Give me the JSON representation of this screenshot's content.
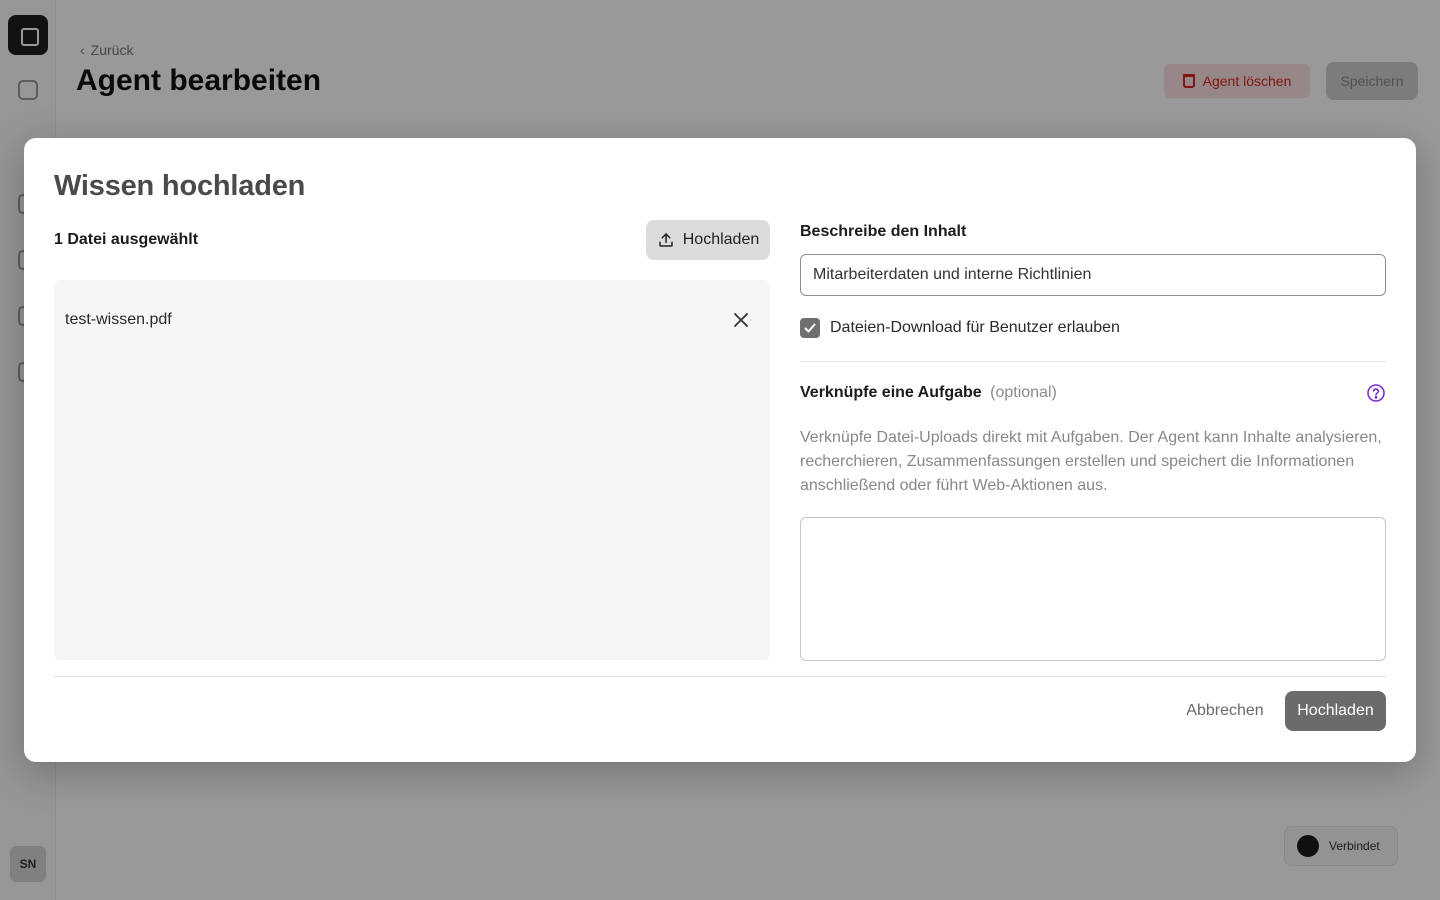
{
  "background": {
    "back_label": "Zurück",
    "page_title": "Agent bearbeiten",
    "delete_label": "Agent löschen",
    "save_label": "Speichern",
    "user_initials": "SN",
    "status_label": "Verbindet"
  },
  "modal": {
    "title": "Wissen hochladen",
    "selected_count": "1 Datei ausgewählt",
    "upload_small_label": "Hochladen",
    "files": [
      {
        "name": "test-wissen.pdf"
      }
    ],
    "description_label": "Beschreibe den Inhalt",
    "description_value": "Mitarbeiterdaten und interne Richtlinien",
    "allow_download_label": "Dateien-Download für Benutzer erlauben",
    "allow_download_checked": true,
    "task_label": "Verknüpfe eine Aufgabe",
    "task_optional": "(optional)",
    "task_help": "Verknüpfe Datei-Uploads direkt mit Aufgaben. Der Agent kann Inhalte analysieren, recherchieren, Zusammenfassungen erstellen und speichert die Informationen anschließend oder führt Web-Aktionen aus.",
    "task_value": "",
    "cancel_label": "Abbrechen",
    "submit_label": "Hochladen"
  },
  "colors": {
    "help_icon": "#7b2fd0",
    "submit_bg": "#6b6b6b",
    "checkbox_bg": "#6f6f6f"
  },
  "icons": {
    "upload": "upload-icon",
    "remove": "close-icon",
    "help": "question-circle-icon",
    "check": "check-icon"
  }
}
